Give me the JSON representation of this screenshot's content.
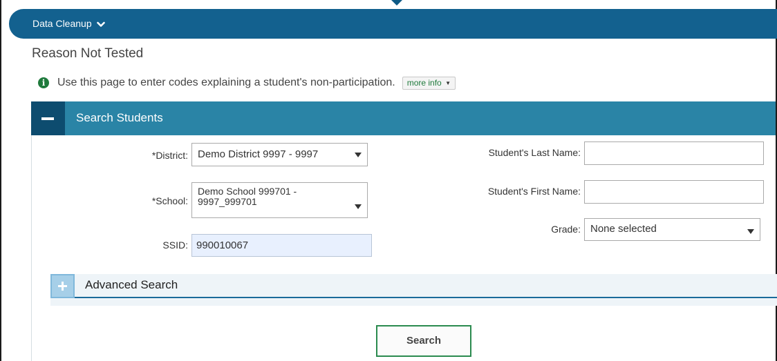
{
  "topbar": {
    "menu_label": "Data Cleanup"
  },
  "page": {
    "title": "Reason Not Tested",
    "info_text": "Use this page to enter codes explaining a student's non-participation.",
    "more_info_label": "more info"
  },
  "panel": {
    "title": "Search Students"
  },
  "form": {
    "district_label": "*District:",
    "district_value": "Demo District 9997 - 9997",
    "school_label": "*School:",
    "school_value_line1": "Demo School 999701 -",
    "school_value_line2": "9997_999701",
    "ssid_label": "SSID:",
    "ssid_value": "990010067",
    "last_name_label": "Student's Last Name:",
    "last_name_value": "",
    "first_name_label": "Student's First Name:",
    "first_name_value": "",
    "grade_label": "Grade:",
    "grade_value": "None selected"
  },
  "advanced": {
    "label": "Advanced Search"
  },
  "actions": {
    "search_label": "Search"
  },
  "colors": {
    "topbar": "#13618f",
    "panel_header": "#2a84a6",
    "panel_button": "#0d4c6f",
    "accent_green": "#1f7a3c",
    "field_highlight": "#e8f0fe"
  },
  "icons": {
    "menu_chevron": "chevron-down-icon",
    "info": "info-icon",
    "collapse": "minus-icon",
    "expand": "plus-icon",
    "select_caret": "caret-down-icon"
  }
}
